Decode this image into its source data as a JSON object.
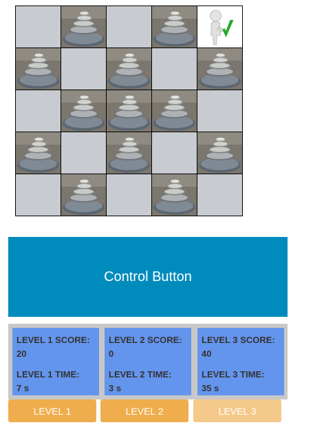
{
  "board": {
    "cells": [
      "empty",
      "stones",
      "empty",
      "stones",
      "target",
      "stones",
      "empty",
      "stones",
      "empty",
      "stones",
      "empty",
      "stones",
      "stones",
      "stones",
      "empty",
      "stones",
      "empty",
      "stones",
      "empty",
      "stones",
      "empty",
      "stones",
      "empty",
      "stones",
      "empty"
    ]
  },
  "control": {
    "label": "Control Button",
    "color": "#008bbd"
  },
  "levels": [
    {
      "score_label": "LEVEL 1 SCORE:",
      "score": "20",
      "time_label": "LEVEL 1 TIME:",
      "time": "7 s",
      "button": "LEVEL 1",
      "button_color": "#f0ad4e"
    },
    {
      "score_label": "LEVEL 2 SCORE:",
      "score": "0",
      "time_label": "LEVEL 2 TIME:",
      "time": "3 s",
      "button": "LEVEL 2",
      "button_color": "#f0ad4e"
    },
    {
      "score_label": "LEVEL 3 SCORE:",
      "score": "40",
      "time_label": "LEVEL 3 TIME:",
      "time": "35 s",
      "button": "LEVEL 3",
      "button_color": "#f5c98a"
    }
  ],
  "colors": {
    "card": "#6495ed",
    "panel": "#c8c8c8",
    "empty_cell": "#c8ccd0"
  }
}
